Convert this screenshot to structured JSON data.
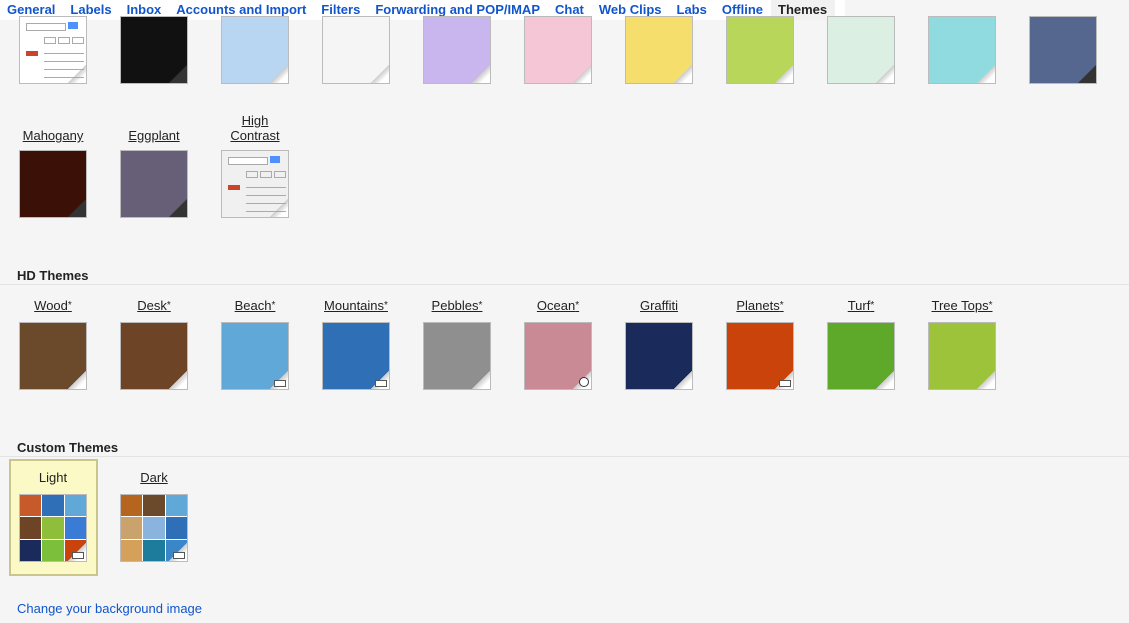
{
  "tabs": [
    "General",
    "Labels",
    "Inbox",
    "Accounts and Import",
    "Filters",
    "Forwarding and POP/IMAP",
    "Chat",
    "Web Clips",
    "Labs",
    "Offline",
    "Themes"
  ],
  "active_tab": "Themes",
  "color_row": {
    "swatches": [
      "#ffffff",
      "#111111",
      "#b8d6f2",
      "#f5f5f5",
      "#c9b6ee",
      "#f4c6d6",
      "#f5de6b",
      "#b8d65a",
      "#dcefe3",
      "#90dbe0",
      "#55668f"
    ]
  },
  "basic_row2": [
    {
      "label": "Mahogany",
      "color": "#3b1006"
    },
    {
      "label": "Eggplant",
      "color": "#675e78"
    },
    {
      "label": "High Contrast",
      "color": "#f0f0f0"
    }
  ],
  "hd_title": "HD Themes",
  "hd_themes": [
    {
      "label": "Wood",
      "star": "*",
      "color": "#6b4a2b",
      "badge": "none"
    },
    {
      "label": "Desk",
      "star": "*",
      "color": "#6e4426",
      "badge": "none"
    },
    {
      "label": "Beach",
      "star": "*",
      "color": "#5fa8d8",
      "badge": "dots"
    },
    {
      "label": "Mountains",
      "star": "*",
      "color": "#2f6fb5",
      "badge": "dots"
    },
    {
      "label": "Pebbles",
      "star": "*",
      "color": "#8f8f8f",
      "badge": "none"
    },
    {
      "label": "Ocean",
      "star": "*",
      "color": "#c98a95",
      "badge": "clock"
    },
    {
      "label": "Graffiti",
      "star": "",
      "color": "#1a2a5a",
      "badge": "none"
    },
    {
      "label": "Planets",
      "star": "*",
      "color": "#c9430b",
      "badge": "dots"
    },
    {
      "label": "Turf",
      "star": "*",
      "color": "#5ea82a",
      "badge": "none"
    },
    {
      "label": "Tree Tops",
      "star": "*",
      "color": "#9cc33a",
      "badge": "none"
    }
  ],
  "custom_title": "Custom Themes",
  "custom_themes": [
    {
      "label": "Light"
    },
    {
      "label": "Dark"
    }
  ],
  "change_bg_link": "Change your background image"
}
